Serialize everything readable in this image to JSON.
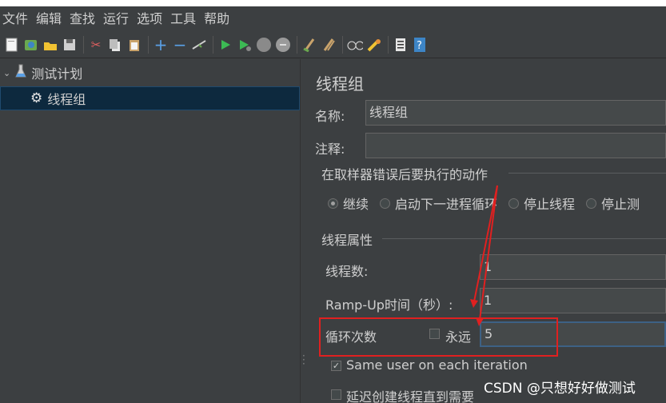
{
  "menu": [
    "文件",
    "编辑",
    "查找",
    "运行",
    "选项",
    "工具",
    "帮助"
  ],
  "toolbar_icons": [
    "new-icon",
    "templates-icon",
    "open-icon",
    "save-icon",
    "cut-icon",
    "copy-icon",
    "paste-icon",
    "expand-icon",
    "collapse-icon",
    "toggle-icon",
    "start-icon",
    "start-no-pause-icon",
    "stop-icon",
    "shutdown-icon",
    "clear-icon",
    "clear-all-icon",
    "search-icon",
    "reset-search-icon",
    "function-helper-icon",
    "help-icon"
  ],
  "tree": {
    "root": "测试计划",
    "child": "线程组"
  },
  "panel": {
    "title": "线程组",
    "name_label": "名称:",
    "name_value": "线程组",
    "comment_label": "注释:",
    "comment_value": "",
    "error_section": "在取样器错误后要执行的动作",
    "radios": [
      "继续",
      "启动下一进程循环",
      "停止线程",
      "停止测"
    ],
    "radio_selected": 0,
    "thread_section": "线程属性",
    "threads_label": "线程数:",
    "threads_value": "1",
    "rampup_label": "Ramp-Up时间（秒）:",
    "rampup_value": "1",
    "loop_label": "循环次数",
    "forever_label": "永远",
    "forever_checked": false,
    "loop_value": "5",
    "same_user_label": "Same user on each iteration",
    "same_user_checked": true,
    "delay_label": "延迟创建线程直到需要",
    "delay_checked": false
  },
  "watermark": "CSDN @只想好好做测试",
  "colors": {
    "annotation": "#e02020",
    "selection": "#0d293e"
  }
}
